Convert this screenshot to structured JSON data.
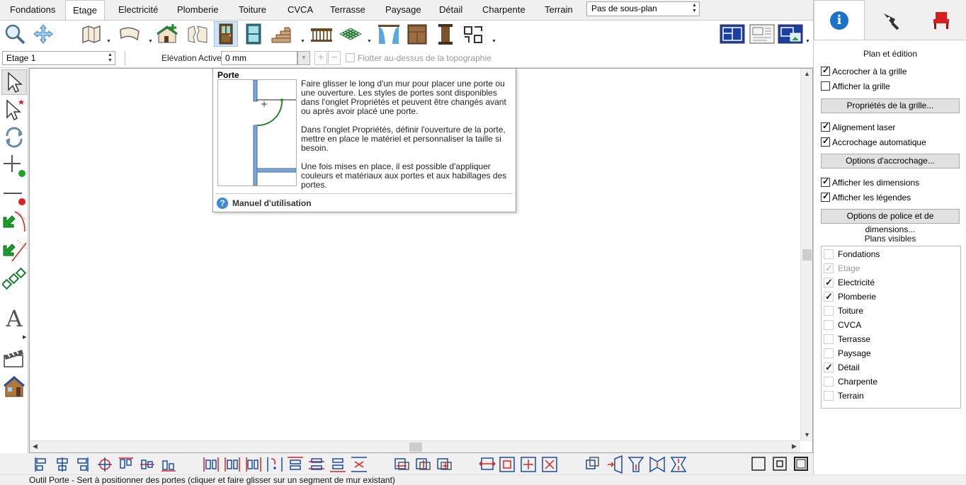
{
  "tabs": [
    "Fondations",
    "Etage",
    "Electricité",
    "Plomberie",
    "Toiture",
    "CVCA",
    "Terrasse",
    "Paysage",
    "Détail",
    "Charpente",
    "Terrain"
  ],
  "active_tab": "Etage",
  "subplan": "Pas de sous-plan",
  "floor_select": "Etage 1",
  "elevation": {
    "label": "Elévation Active:",
    "value": "0 mm"
  },
  "float_label": "Flotter au-dessus de la topographie",
  "tooltip": {
    "title": "Porte",
    "p1": "Faire glisser le long d'un mur pour placer une porte ou une ouverture. Les styles de portes sont disponibles dans l'onglet Propriétés et peuvent être changés avant ou après avoir placé une porte.",
    "p2": "Dans l'onglet Propriétés, définir l'ouverture de la porte, mettre en place le matériel et personnaliser la taille si besoin.",
    "p3": "Une fois mises en place, il est possible d'appliquer couleurs et matériaux aux portes et aux habillages des portes.",
    "manual": "Manuel d'utilisation",
    "help_glyph": "?"
  },
  "right_panel": {
    "header": "Plan et édition",
    "snap_grid": "Accrocher à la grille",
    "show_grid": "Afficher la grille",
    "grid_props": "Propriétés de la grille...",
    "laser": "Alignement laser",
    "auto_snap": "Accrochage automatique",
    "snap_options": "Options d'accrochage...",
    "show_dims": "Afficher les dimensions",
    "show_labels": "Afficher les légendes",
    "font_options": "Options de police et de dimensions...",
    "visible_header": "Plans visibles",
    "info_glyph": "i",
    "visible_plans": [
      {
        "name": "Fondations",
        "state": "off"
      },
      {
        "name": "Etage",
        "state": "dim"
      },
      {
        "name": "Electricité",
        "state": "on"
      },
      {
        "name": "Plomberie",
        "state": "on"
      },
      {
        "name": "Toiture",
        "state": "off"
      },
      {
        "name": "CVCA",
        "state": "off"
      },
      {
        "name": "Terrasse",
        "state": "off"
      },
      {
        "name": "Paysage",
        "state": "off"
      },
      {
        "name": "Détail",
        "state": "on"
      },
      {
        "name": "Charpente",
        "state": "off"
      },
      {
        "name": "Terrain",
        "state": "off"
      }
    ]
  },
  "status": "Outil Porte - Sert à  positionner des portes (cliquer et faire glisser sur un segment de mur existant)",
  "left_text_tool": "A",
  "colors": {
    "accent": "#1a73c9",
    "selected": "#cfe3f6",
    "door_brown": "#6b4a2a"
  }
}
